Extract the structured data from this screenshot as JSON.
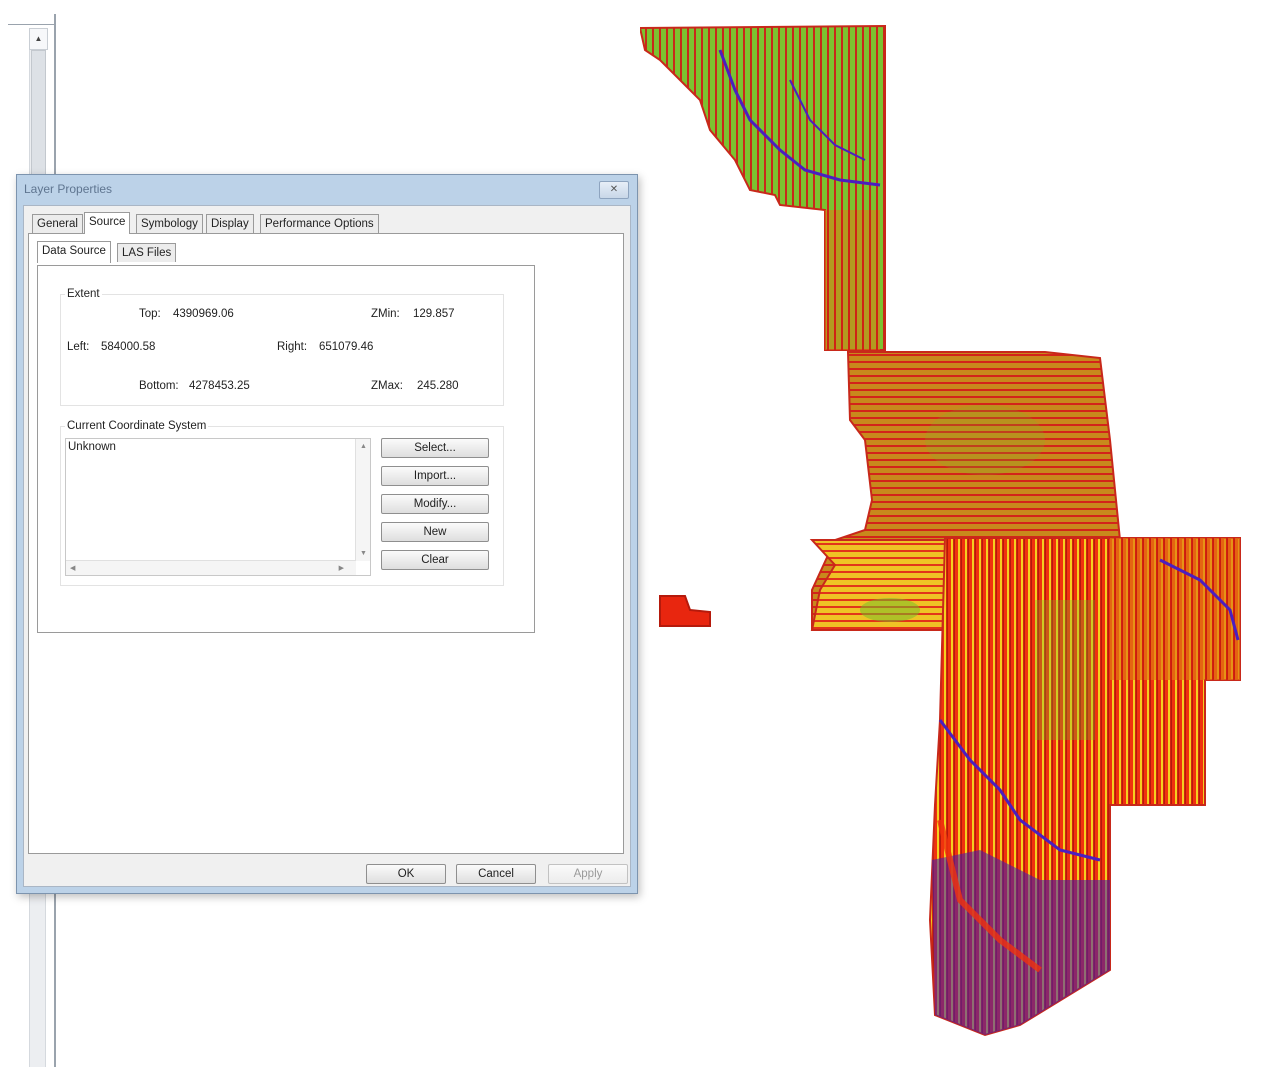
{
  "dialog": {
    "title": "Layer Properties",
    "close_glyph": "✕"
  },
  "tabs": [
    {
      "label": "General",
      "active": false
    },
    {
      "label": "Source",
      "active": true
    },
    {
      "label": "Symbology",
      "active": false
    },
    {
      "label": "Display",
      "active": false
    },
    {
      "label": "Performance Options",
      "active": false
    }
  ],
  "subtabs": [
    {
      "label": "Data Source",
      "active": true
    },
    {
      "label": "LAS Files",
      "active": false
    }
  ],
  "extent": {
    "legend": "Extent",
    "top_label": "Top:",
    "top_value": "4390969.06",
    "zmin_label": "ZMin:",
    "zmin_value": "129.857",
    "left_label": "Left:",
    "left_value": "584000.58",
    "right_label": "Right:",
    "right_value": "651079.46",
    "bottom_label": "Bottom:",
    "bottom_value": "4278453.25",
    "zmax_label": "ZMax:",
    "zmax_value": "245.280"
  },
  "coordinate_system": {
    "legend": "Current Coordinate System",
    "value": "Unknown",
    "buttons": [
      "Select...",
      "Import...",
      "Modify...",
      "New",
      "Clear"
    ]
  },
  "footer": {
    "ok": "OK",
    "cancel": "Cancel",
    "apply": "Apply"
  },
  "colors": {
    "map_red": "#e8260f",
    "map_orange": "#e07a12",
    "map_green": "#6fbf2a",
    "map_yellow": "#e6d622",
    "map_blue": "#3a1fb5"
  }
}
